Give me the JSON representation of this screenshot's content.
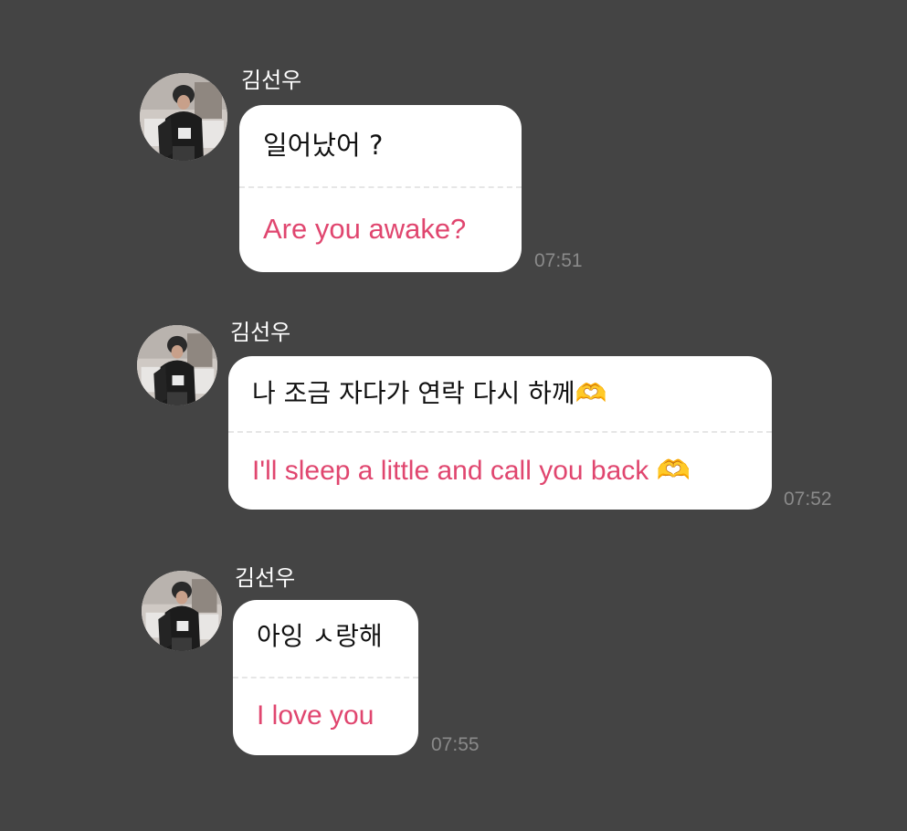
{
  "messages": [
    {
      "sender": "김선우",
      "original": "일어났어 ?",
      "translation": "Are you awake?",
      "time": "07:51",
      "avatar_icon": "profile-photo"
    },
    {
      "sender": "김선우",
      "original": "나  조금 자다가 연락 다시 하께🫶",
      "translation": "I'll sleep a little and call you back 🫶",
      "time": "07:52",
      "avatar_icon": "profile-photo"
    },
    {
      "sender": "김선우",
      "original": "아잉 ㅅ랑해",
      "translation": "I love you",
      "time": "07:55",
      "avatar_icon": "profile-photo"
    }
  ],
  "colors": {
    "background": "#444444",
    "bubble": "#ffffff",
    "original_text": "#111111",
    "translation_text": "#e0466f",
    "timestamp": "#8a8a8a",
    "sender_name": "#ffffff"
  }
}
